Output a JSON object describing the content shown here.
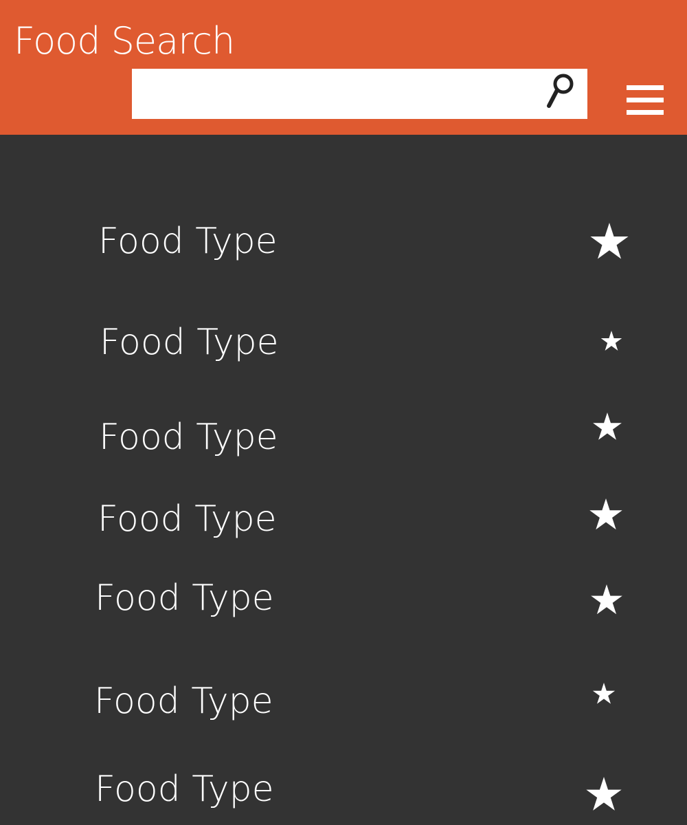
{
  "header": {
    "title": "Food Search",
    "search": {
      "value": "",
      "placeholder": ""
    }
  },
  "icons": {
    "search": "magnifier-icon",
    "menu": "hamburger-menu-icon",
    "favorite": "star-icon"
  },
  "colors": {
    "header_background": "#DF5A30",
    "list_background": "#333333",
    "text": "#FFFFFF"
  },
  "food_list": [
    {
      "label": "Food Type"
    },
    {
      "label": "Food Type"
    },
    {
      "label": "Food Type"
    },
    {
      "label": "Food Type"
    },
    {
      "label": "Food Type"
    },
    {
      "label": "Food Type"
    },
    {
      "label": "Food Type"
    }
  ]
}
